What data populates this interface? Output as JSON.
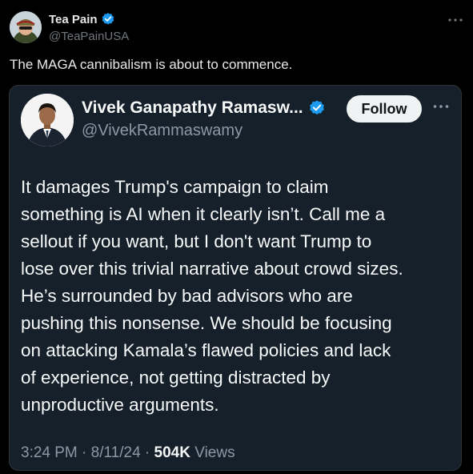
{
  "outer_tweet": {
    "display_name": "Tea Pain",
    "handle": "@TeaPainUSA",
    "text": "The MAGA cannibalism is about to commence.",
    "verified": true,
    "more_icon": "more-horizontal-icon"
  },
  "quoted_tweet": {
    "display_name": "Vivek Ganapathy Ramasw...",
    "handle": "@VivekRammaswamy",
    "verified": true,
    "follow_label": "Follow",
    "more_icon": "more-horizontal-icon",
    "lines": [
      "It damages Trump's campaign to claim",
      "something is AI when it clearly isn’t. Call me a",
      "sellout if you want, but I don't want Trump to",
      "lose over this trivial narrative about crowd sizes.",
      "He’s surrounded by bad advisors who are",
      "pushing this nonsense. We should be focusing",
      "on attacking Kamala’s flawed policies and lack",
      "of experience, not getting distracted by",
      "unproductive arguments."
    ],
    "time": "3:24 PM",
    "date": "8/11/24",
    "separator": "·",
    "views_count": "504K",
    "views_label": "Views"
  },
  "colors": {
    "background": "#000000",
    "card_background": "#16202b",
    "verified_blue": "#1d9bf0",
    "secondary_text": "#71767b"
  }
}
